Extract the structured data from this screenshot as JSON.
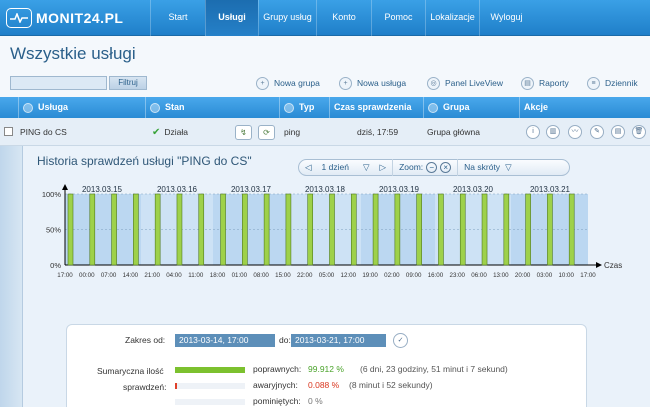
{
  "app": {
    "logo_text": "MONIT24.PL"
  },
  "nav": [
    {
      "label": "Start",
      "width": 55
    },
    {
      "label": "Usługi",
      "width": 53
    },
    {
      "label": "Grupy usług",
      "width": 58
    },
    {
      "label": "Konto",
      "width": 55
    },
    {
      "label": "Pomoc",
      "width": 54
    },
    {
      "label": "Lokalizacje",
      "width": 54
    },
    {
      "label": "Wyloguj",
      "width": 54
    }
  ],
  "page": {
    "title": "Wszystkie usługi"
  },
  "filter": {
    "value": "",
    "button_label": "Filtruj"
  },
  "actions": {
    "new_group": "Nowa grupa",
    "new_service": "Nowa usługa",
    "liveview": "Panel LiveView",
    "reports": "Raporty",
    "journal": "Dziennik"
  },
  "table": {
    "headers": {
      "service": "Usługa",
      "status": "Stan",
      "type": "Typ",
      "check_time": "Czas sprawdzenia",
      "group": "Grupa",
      "actions": "Akcje"
    },
    "row": {
      "service": "PING do CS",
      "status": "Działa",
      "type": "ping",
      "check_time": "dziś, 17:59",
      "group": "Grupa główna"
    }
  },
  "history": {
    "title": "Historia sprawdzeń usługi \"PING do CS\"",
    "controls": {
      "range_label": "1 dzień",
      "zoom_label": "Zoom:",
      "shortcuts_label": "Na skróty"
    }
  },
  "chart_data": {
    "type": "bar",
    "x_axis_label": "Czas",
    "y_ticks": [
      "100%",
      "50%",
      "0%"
    ],
    "ylim": [
      0,
      100
    ],
    "day_labels": [
      "2013.03.15",
      "2013.03.16",
      "2013.03.17",
      "2013.03.18",
      "2013.03.19",
      "2013.03.20",
      "2013.03.21"
    ],
    "time_labels": [
      "17:00",
      "00:00",
      "07:00",
      "14:00",
      "21:00",
      "04:00",
      "11:00",
      "18:00",
      "01:00",
      "08:00",
      "15:00",
      "22:00",
      "05:00",
      "12:00",
      "19:00",
      "02:00",
      "09:00",
      "16:00",
      "23:00",
      "06:00",
      "13:00",
      "20:00",
      "03:00",
      "10:00",
      "17:00"
    ],
    "values": [
      100,
      100,
      100,
      100,
      100,
      100,
      100,
      100,
      100,
      100,
      100,
      100,
      100,
      100,
      100,
      100,
      100,
      100,
      100,
      100,
      100,
      100,
      100,
      100
    ],
    "bar_color": "#9ed14a",
    "grid": true
  },
  "summary": {
    "range_label": "Zakres od:",
    "date_from": "2013-03-14, 17:00",
    "to_label": "do:",
    "date_to": "2013-03-21, 17:00",
    "total_label": "Sumaryczna ilość",
    "checks_label": "sprawdzeń:",
    "rows": [
      {
        "label": "poprawnych:",
        "value": "99.912 %",
        "detail": "(6 dni, 23 godziny, 51 minut i 7 sekund)",
        "fraction": 0.99912,
        "color": "#7cc12e",
        "value_color": "#4aa32a"
      },
      {
        "label": "awaryjnych:",
        "value": "0.088 %",
        "detail": "(8 minut i 52 sekundy)",
        "fraction": 0.00088,
        "color": "#e0402a",
        "value_color": "#d9361e"
      },
      {
        "label": "pominiętych:",
        "value": "0 %",
        "detail": "",
        "fraction": 0,
        "color": "#9aa8b5",
        "value_color": "#777"
      }
    ]
  }
}
